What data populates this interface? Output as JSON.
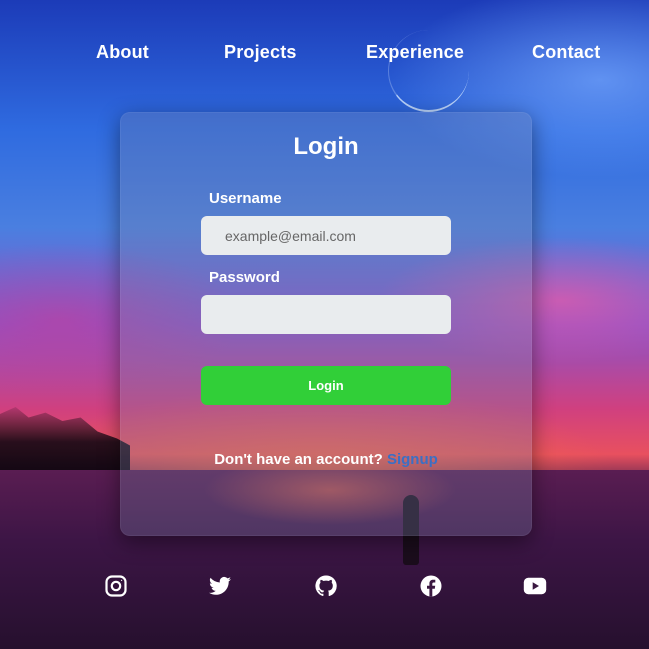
{
  "nav": {
    "items": [
      {
        "label": "About"
      },
      {
        "label": "Projects"
      },
      {
        "label": "Experience"
      },
      {
        "label": "Contact"
      }
    ]
  },
  "login": {
    "title": "Login",
    "username_label": "Username",
    "username_placeholder": "example@email.com",
    "username_value": "",
    "password_label": "Password",
    "password_value": "",
    "button_label": "Login",
    "signup_prompt": "Don't have an account?",
    "signup_link": "Signup",
    "colors": {
      "button": "#31cf38",
      "link": "#3b6fc4"
    }
  },
  "socials": [
    {
      "icon": "instagram-icon"
    },
    {
      "icon": "twitter-icon"
    },
    {
      "icon": "github-icon"
    },
    {
      "icon": "facebook-icon"
    },
    {
      "icon": "youtube-icon"
    }
  ]
}
